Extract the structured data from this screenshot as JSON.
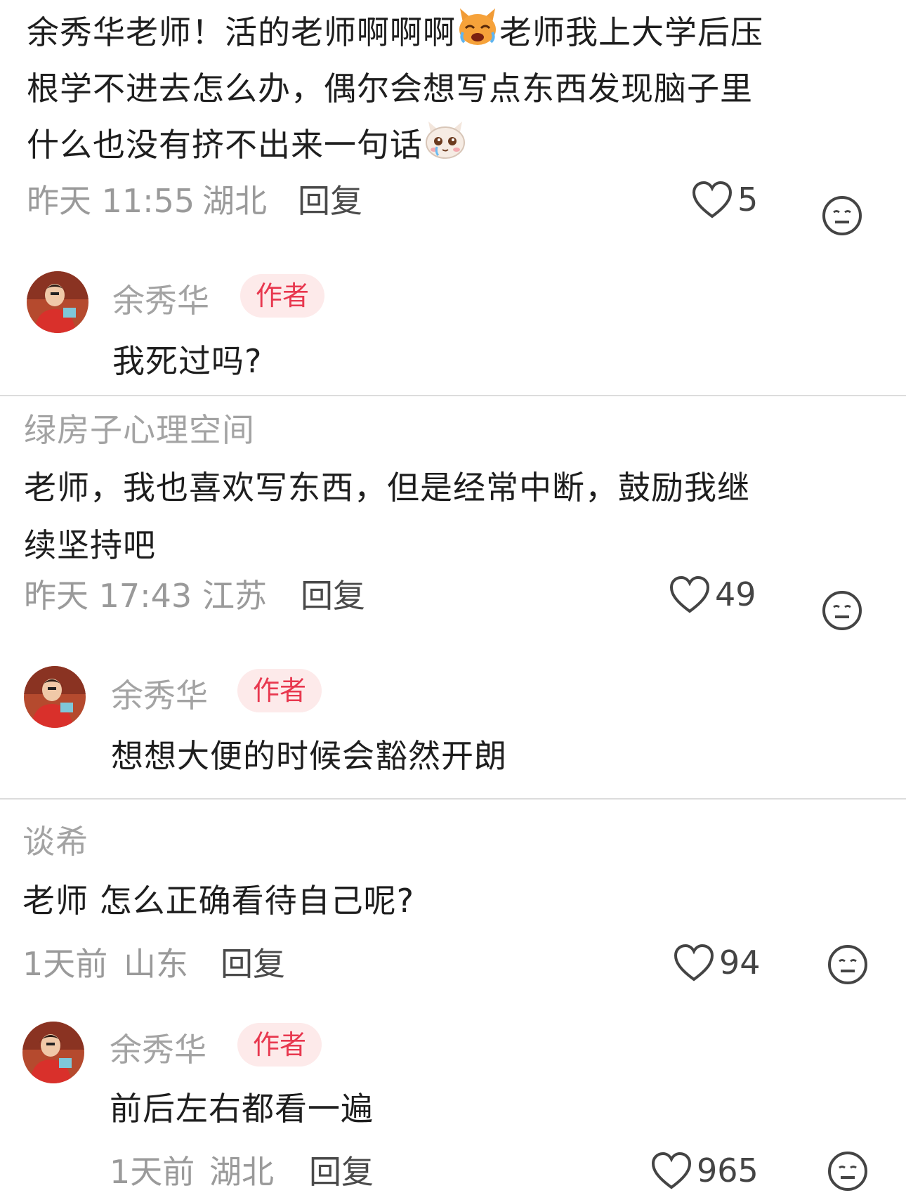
{
  "comments": [
    {
      "lines": [
        "余秀华老师！活的老师啊啊啊",
        "老师我上大学后压",
        "根学不进去怎么办，偶尔会想写点东西发现脑子里",
        "什么也没有挤不出来一句话"
      ],
      "emoji_1": "crying-cat-emoji",
      "emoji_2": "teary-cat-emoji",
      "time": "昨天 11:55",
      "region": "湖北",
      "reply_label": "回复",
      "likes": "5",
      "author_reply": {
        "name": "余秀华",
        "badge": "作者",
        "text": "我死过吗?"
      }
    },
    {
      "username": "绿房子心理空间",
      "lines": [
        "老师，我也喜欢写东西，但是经常中断，鼓励我继",
        "续坚持吧"
      ],
      "time": "昨天 17:43",
      "region": "江苏",
      "reply_label": "回复",
      "likes": "49",
      "author_reply": {
        "name": "余秀华",
        "badge": "作者",
        "text": "想想大便的时候会豁然开朗"
      }
    },
    {
      "username": "谈希",
      "lines": [
        "老师 怎么正确看待自己呢?"
      ],
      "time": "1天前",
      "region": "山东",
      "reply_label": "回复",
      "likes": "94",
      "author_reply": {
        "name": "余秀华",
        "badge": "作者",
        "text": "前后左右都看一遍",
        "time": "1天前",
        "region": "湖北",
        "reply_label": "回复",
        "likes": "965"
      }
    }
  ],
  "colors": {
    "badge_text": "#e8384f",
    "badge_bg": "#fdeaea",
    "muted": "#9a9a9a"
  }
}
